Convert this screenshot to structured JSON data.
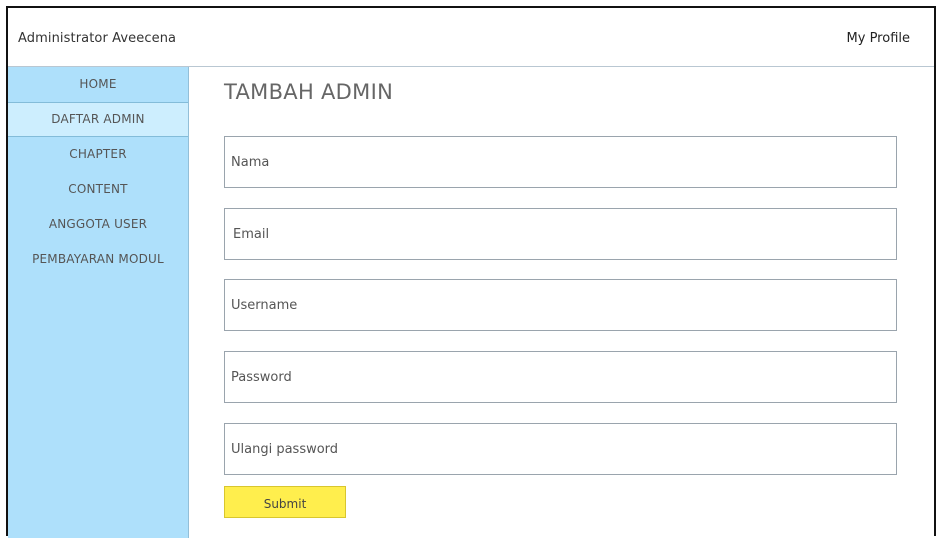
{
  "header": {
    "brand": "Administrator Aveecena",
    "profile_link": "My Profile"
  },
  "sidebar": {
    "items": [
      {
        "label": "HOME"
      },
      {
        "label": "DAFTAR ADMIN"
      },
      {
        "label": "CHAPTER"
      },
      {
        "label": "CONTENT"
      },
      {
        "label": "ANGGOTA USER"
      },
      {
        "label": "PEMBAYARAN MODUL"
      }
    ],
    "active_index": 1
  },
  "main": {
    "title": "TAMBAH ADMIN",
    "fields": [
      {
        "placeholder": "Nama",
        "value": ""
      },
      {
        "placeholder": "Email",
        "value": ""
      },
      {
        "placeholder": "Username",
        "value": ""
      },
      {
        "placeholder": "Password",
        "value": ""
      },
      {
        "placeholder": "Ulangi password",
        "value": ""
      }
    ],
    "submit_label": "Submit"
  },
  "colors": {
    "sidebar_bg": "#aee0fb",
    "sidebar_active_bg": "#cdeefe",
    "submit_bg": "#ffee4d"
  }
}
